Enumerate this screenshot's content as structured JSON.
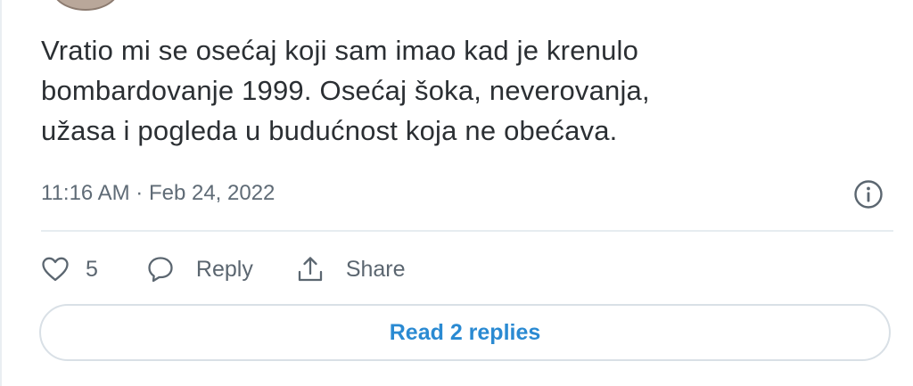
{
  "tweet": {
    "text_lines": [
      "Vratio mi se osećaj koji sam imao kad je krenulo",
      "bombardovanje 1999. Osećaj šoka, neverovanja,",
      "užasa i pogleda u budućnost koja ne obećava."
    ],
    "timestamp": "11:16 AM · Feb 24, 2022"
  },
  "actions": {
    "like_icon": "heart-icon",
    "like_count": "5",
    "reply_icon": "speech-bubble-icon",
    "reply_label": "Reply",
    "share_icon": "share-upload-icon",
    "share_label": "Share",
    "info_icon": "info-circle-icon"
  },
  "replies_button": {
    "label": "Read 2 replies"
  },
  "colors": {
    "text": "#2b2f33",
    "muted": "#5f6b76",
    "link_blue": "#2a8ad2",
    "divider": "#e6ecf0"
  }
}
